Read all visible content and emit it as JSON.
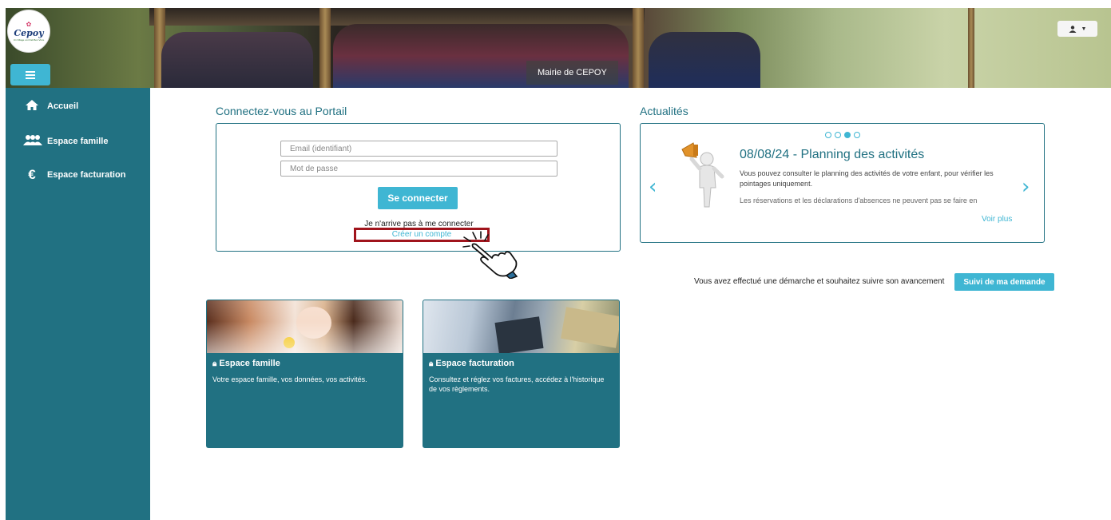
{
  "header": {
    "logo_text": "Cepoy",
    "logo_subtitle": "Un Village où il fait Bon Vivre",
    "banner_caption": "Mairie de CEPOY",
    "user_menu_icon": "user-icon"
  },
  "sidebar": {
    "items": [
      {
        "label": "Accueil",
        "icon": "home-icon"
      },
      {
        "label": "Espace famille",
        "icon": "family-icon"
      },
      {
        "label": "Espace facturation",
        "icon": "euro-icon"
      }
    ]
  },
  "login": {
    "title": "Connectez-vous au Portail",
    "email_placeholder": "Email (identifiant)",
    "password_placeholder": "Mot de passe",
    "connect_label": "Se connecter",
    "cant_connect": "Je n'arrive pas à me connecter",
    "create_account": "Créer un compte"
  },
  "news": {
    "title": "Actualités",
    "item_title": "08/08/24 - Planning des activités",
    "text_1": "Vous pouvez consulter le planning des activités de votre enfant, pour vérifier les pointages uniquement.",
    "text_2": "Les réservations et les déclarations d'absences ne peuvent pas se faire en",
    "more_label": "Voir plus",
    "prev_icon": "chevron-left-icon",
    "next_icon": "chevron-right-icon",
    "active_slide": 3,
    "slide_count": 4
  },
  "tracking": {
    "text": "Vous avez effectué une démarche et souhaitez suivre son avancement",
    "button_label": "Suivi de ma demande"
  },
  "cards": [
    {
      "title": "Espace famille",
      "description": "Votre espace famille, vos données, vos activités."
    },
    {
      "title": "Espace facturation",
      "description": "Consultez et réglez vos factures, accédez à l'historique de vos règlements."
    }
  ],
  "colors": {
    "primary": "#217182",
    "accent": "#3fb6d3",
    "highlight_border": "#a0141c"
  }
}
